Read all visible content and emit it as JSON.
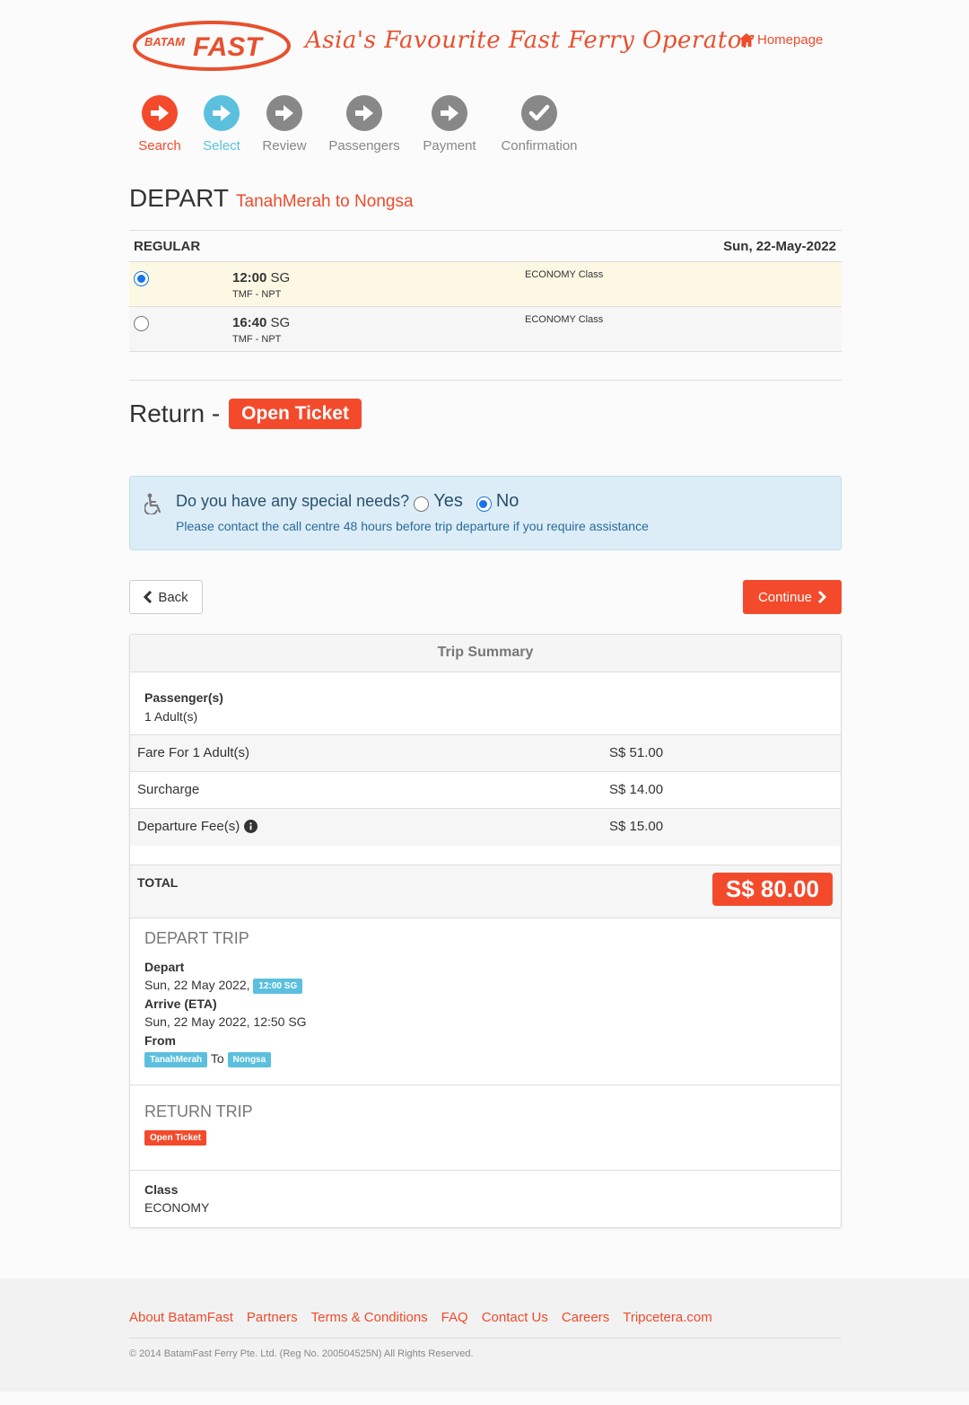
{
  "header": {
    "logo_top": "BATAM",
    "logo_main": "FAST",
    "tagline": "Asia's Favourite Fast Ferry Operator",
    "home_link": "Homepage"
  },
  "steps": [
    {
      "label": "Search",
      "state": "done",
      "color": "#f44a2c"
    },
    {
      "label": "Select",
      "state": "active",
      "color": "#5bc0de"
    },
    {
      "label": "Review",
      "state": "todo",
      "color": "#888888"
    },
    {
      "label": "Passengers",
      "state": "todo",
      "color": "#888888"
    },
    {
      "label": "Payment",
      "state": "todo",
      "color": "#888888"
    },
    {
      "label": "Confirmation",
      "state": "todo",
      "color": "#888888"
    }
  ],
  "depart": {
    "heading": "DEPART",
    "route": "TanahMerah to Nongsa",
    "table_type": "REGULAR",
    "date": "Sun, 22-May-2022",
    "trips": [
      {
        "time": "12:00",
        "zone": "SG",
        "code": "TMF - NPT",
        "class": "ECONOMY Class",
        "selected": true
      },
      {
        "time": "16:40",
        "zone": "SG",
        "code": "TMF - NPT",
        "class": "ECONOMY Class",
        "selected": false
      }
    ]
  },
  "return_section": {
    "heading": "Return -",
    "badge": "Open Ticket"
  },
  "special_needs": {
    "question": "Do you have any special needs?",
    "yes": "Yes",
    "no": "No",
    "selected": "No",
    "note": "Please contact the call centre 48 hours before trip departure if you require assistance"
  },
  "buttons": {
    "back": "Back",
    "continue": "Continue"
  },
  "summary": {
    "title": "Trip Summary",
    "passengers_label": "Passenger(s)",
    "passengers_value": "1 Adult(s)",
    "fare_label": "Fare For 1 Adult(s)",
    "fare_value": "S$ 51.00",
    "surcharge_label": "Surcharge",
    "surcharge_value": "S$ 14.00",
    "departure_fee_label": "Departure Fee(s)",
    "departure_fee_value": "S$ 15.00",
    "total_label": "TOTAL",
    "total_value": "S$ 80.00",
    "depart_trip": {
      "title": "DEPART TRIP",
      "depart_label": "Depart",
      "depart_date": "Sun, 22 May 2022,",
      "depart_time_tag": "12:00 SG",
      "arrive_label": "Arrive (ETA)",
      "arrive_value": "Sun, 22 May 2022, 12:50 SG",
      "from_label": "From",
      "from_tag": "TanahMerah",
      "to_word": "To",
      "to_tag": "Nongsa"
    },
    "return_trip": {
      "title": "RETURN TRIP",
      "tag": "Open Ticket"
    },
    "class_label": "Class",
    "class_value": "ECONOMY"
  },
  "footer": {
    "links": [
      "About BatamFast",
      "Partners",
      "Terms & Conditions",
      "FAQ",
      "Contact Us",
      "Careers",
      "Tripcetera.com"
    ],
    "copyright": "© 2014 BatamFast Ferry Pte. Ltd. (Reg No. 200504525N) All Rights Reserved."
  },
  "colors": {
    "brand": "#f44a2c",
    "info": "#5bc0de",
    "inactive": "#888888",
    "needs_bg": "#dcedf7"
  }
}
